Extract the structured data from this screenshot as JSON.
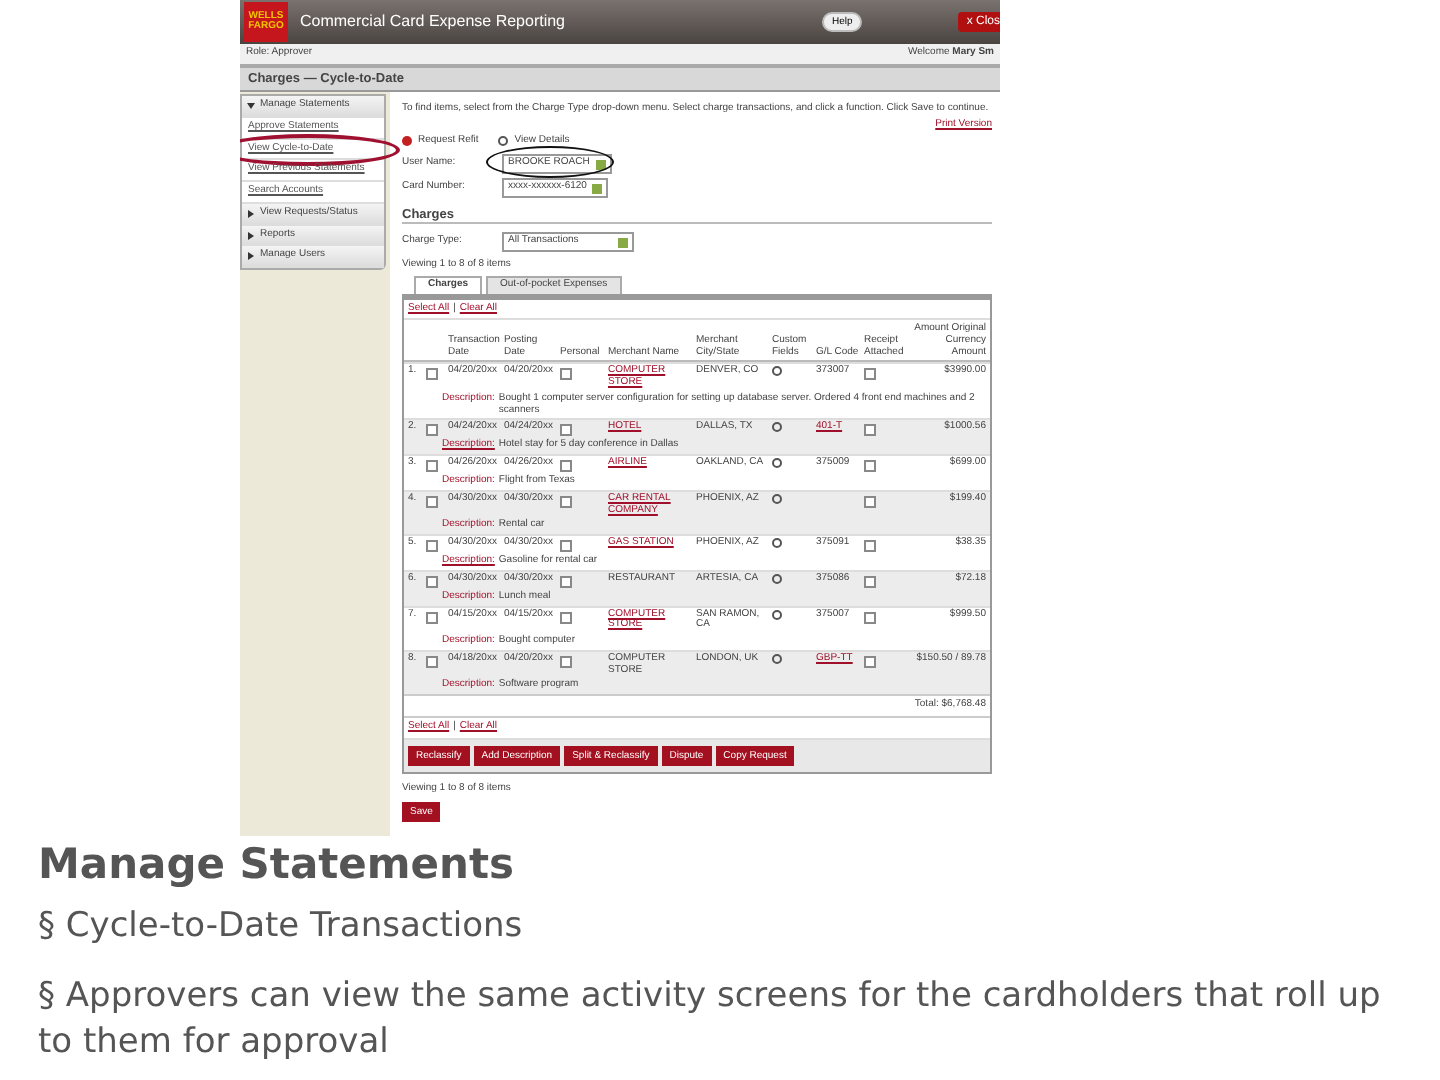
{
  "app": {
    "logo": [
      "WELLS",
      "FARGO"
    ],
    "title": "Commercial Card Expense Reporting",
    "help": "Help",
    "close": "x Clos",
    "role": "Role: Approver",
    "welcome": "Welcome",
    "user": "Mary Sm",
    "page_title": "Charges — Cycle-to-Date"
  },
  "sidebar": [
    {
      "label": "Manage Statements",
      "kind": "section",
      "expanded": true
    },
    {
      "label": "Approve Statements",
      "kind": "link",
      "circled": false
    },
    {
      "label": "View Cycle-to-Date",
      "kind": "link",
      "circled": true
    },
    {
      "label": "View Previous Statements",
      "kind": "link",
      "circled": false
    },
    {
      "label": "Search Accounts",
      "kind": "link",
      "circled": false
    },
    {
      "label": "View Requests/Status",
      "kind": "section",
      "expanded": false
    },
    {
      "label": "Reports",
      "kind": "section",
      "expanded": false
    },
    {
      "label": "Manage Users",
      "kind": "section",
      "expanded": false
    }
  ],
  "instructions": "To find items, select from the Charge Type drop-down menu. Select charge transactions, and click a function. Click Save to continue.",
  "print": "Print Version",
  "actions": [
    "Request Refit",
    "View Details"
  ],
  "fields": [
    {
      "label": "User Name:",
      "value": "BROOKE ROACH",
      "circled": true
    },
    {
      "label": "Card Number:",
      "value": "xxxx-xxxxxx-6120",
      "circled": false
    }
  ],
  "charges_heading": "Charges",
  "charge_type": {
    "label": "Charge Type:",
    "value": "All Transactions"
  },
  "viewing_top": "Viewing 1 to 8 of 8 items",
  "tabs": [
    {
      "label": "Charges",
      "selected": true
    },
    {
      "label": "Out-of-pocket Expenses",
      "selected": false
    }
  ],
  "select_top": [
    "Select All",
    "|",
    "Clear All"
  ],
  "select_bottom": [
    "Select All",
    "|",
    "Clear All"
  ],
  "columns": [
    "Transaction Date",
    "Posting Date",
    "Personal",
    "Merchant Name",
    "Merchant City/State",
    "Custom Fields",
    "G/L Code",
    "Receipt Attached",
    "Amount Original Currency Amount"
  ],
  "rows": [
    {
      "num": "1.",
      "checked": false,
      "tdate": "04/20/20xx",
      "pdate": "04/20/20xx",
      "personal": false,
      "merchant": "COMPUTER STORE",
      "merchant_link": true,
      "city": "DENVER, CO",
      "gl": "373007",
      "gl_link": false,
      "receipt": false,
      "amount": "$3990.00",
      "desc_label": "Description:",
      "desc_link": false,
      "desc": "Bought 1 computer server configuration for setting up database server. Ordered 4 front end machines and 2 scanners"
    },
    {
      "num": "2.",
      "checked": false,
      "tdate": "04/24/20xx",
      "pdate": "04/24/20xx",
      "personal": false,
      "merchant": "HOTEL",
      "merchant_link": true,
      "city": "DALLAS, TX",
      "gl": "401-T",
      "gl_link": true,
      "receipt": false,
      "amount": "$1000.56",
      "desc_label": "Description:",
      "desc_link": true,
      "desc": "Hotel stay for 5 day conference in Dallas"
    },
    {
      "num": "3.",
      "checked": false,
      "tdate": "04/26/20xx",
      "pdate": "04/26/20xx",
      "personal": false,
      "merchant": "AIRLINE",
      "merchant_link": true,
      "city": "OAKLAND, CA",
      "gl": "375009",
      "gl_link": false,
      "receipt": false,
      "amount": "$699.00",
      "desc_label": "Description:",
      "desc_link": false,
      "desc": "Flight from Texas"
    },
    {
      "num": "4.",
      "checked": false,
      "tdate": "04/30/20xx",
      "pdate": "04/30/20xx",
      "personal": false,
      "merchant": "CAR RENTAL COMPANY",
      "merchant_link": true,
      "city": "PHOENIX, AZ",
      "gl": "",
      "receipt": false,
      "amount": "$199.40",
      "desc_label": "Description:",
      "desc_link": false,
      "desc": "Rental car"
    },
    {
      "num": "5.",
      "checked": false,
      "tdate": "04/30/20xx",
      "pdate": "04/30/20xx",
      "personal": false,
      "merchant": "GAS STATION",
      "merchant_link": true,
      "city": "PHOENIX, AZ",
      "gl": "375091",
      "gl_link": false,
      "receipt": false,
      "amount": "$38.35",
      "desc_label": "Description:",
      "desc_link": true,
      "desc": "Gasoline for rental car"
    },
    {
      "num": "6.",
      "checked": false,
      "tdate": "04/30/20xx",
      "pdate": "04/30/20xx",
      "personal": false,
      "merchant": "RESTAURANT",
      "merchant_link": false,
      "city": "ARTESIA, CA",
      "gl": "375086",
      "gl_link": false,
      "receipt": false,
      "amount": "$72.18",
      "desc_label": "Description:",
      "desc_link": false,
      "desc": "Lunch meal"
    },
    {
      "num": "7.",
      "checked": false,
      "tdate": "04/15/20xx",
      "pdate": "04/15/20xx",
      "personal": false,
      "merchant": "COMPUTER STORE",
      "merchant_link": true,
      "city": "SAN RAMON, CA",
      "gl": "375007",
      "gl_link": false,
      "receipt": false,
      "amount": "$999.50",
      "desc_label": "Description:",
      "desc_link": false,
      "desc": "Bought computer"
    },
    {
      "num": "8.",
      "checked": false,
      "tdate": "04/18/20xx",
      "pdate": "04/20/20xx",
      "personal": false,
      "merchant": "COMPUTER STORE",
      "merchant_link": false,
      "city": "LONDON, UK",
      "gl": "GBP-TT",
      "gl_link": true,
      "receipt": false,
      "amount": "$150.50 / 89.78",
      "desc_label": "Description:",
      "desc_link": false,
      "desc": "Software program"
    }
  ],
  "total": "Total: $6,768.48",
  "buttons": [
    "Reclassify",
    "Add Description",
    "Split & Reclassify",
    "Dispute",
    "Copy Request"
  ],
  "viewing_bottom": "Viewing 1 to 8 of 8 items",
  "save": "Save",
  "slide": {
    "title": "Manage Statements",
    "bullets": [
      {
        "marker": "§",
        "text": "Cycle-to-Date Transactions"
      },
      {
        "marker": "§",
        "text": "Approvers can view the same activity screens for the cardholders that roll up to them for approval"
      }
    ]
  }
}
